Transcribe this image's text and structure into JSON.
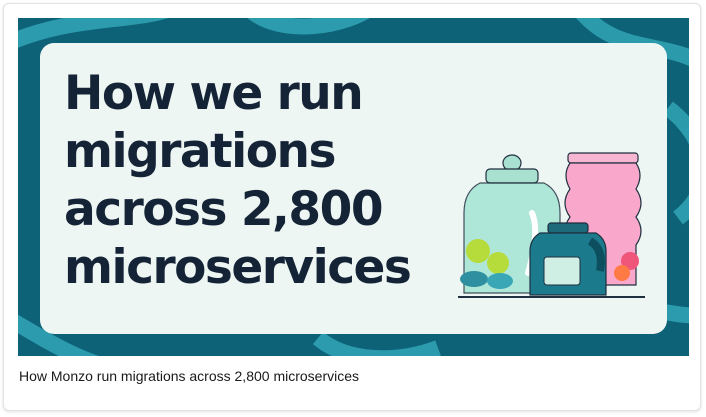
{
  "article_card": {
    "image": {
      "headline_lines": [
        "How we run",
        "migrations",
        "across 2,800",
        "microservices"
      ],
      "illustration": "glass-jars-illustration",
      "colors": {
        "background": "#0e6277",
        "panel": "#eef6f3",
        "headline": "#152337"
      }
    },
    "caption": "How Monzo run migrations across 2,800 microservices"
  }
}
